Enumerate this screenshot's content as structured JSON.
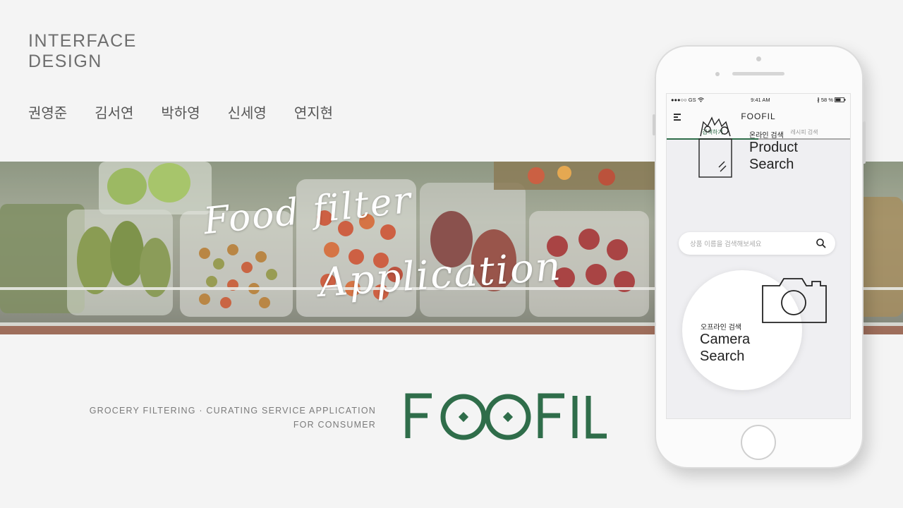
{
  "header": {
    "title_line1": "INTERFACE",
    "title_line2": "DESIGN"
  },
  "team": [
    "권영준",
    "김서연",
    "박하영",
    "신세영",
    "연지현"
  ],
  "banner": {
    "script_line1": "Food filter",
    "script_line2": "Application"
  },
  "tagline": {
    "line1": "GROCERY FILTERING · CURATING SERVICE APPLICATION",
    "line2": "FOR CONSUMER"
  },
  "logo": {
    "text": "FOOFIL",
    "color": "#2f6d4a"
  },
  "phone": {
    "status": {
      "carrier": "●●●○○ GS",
      "time": "9:41 AM",
      "battery": "58 %"
    },
    "app_title": "FOOFIL",
    "tabs": [
      {
        "label": "검색하기",
        "active": true
      },
      {
        "label": "레시피 검색",
        "active": false
      }
    ],
    "product_search": {
      "subtitle": "온라인 검색",
      "title_line1": "Product",
      "title_line2": "Search"
    },
    "search": {
      "placeholder": "상품 이름을 검색해보세요"
    },
    "camera_search": {
      "subtitle": "오프라인 검색",
      "title_line1": "Camera",
      "title_line2": "Search"
    },
    "icons": [
      "menu-icon",
      "grocery-bag-icon",
      "search-icon",
      "camera-icon",
      "wifi-icon",
      "bluetooth-icon",
      "battery-icon"
    ]
  }
}
